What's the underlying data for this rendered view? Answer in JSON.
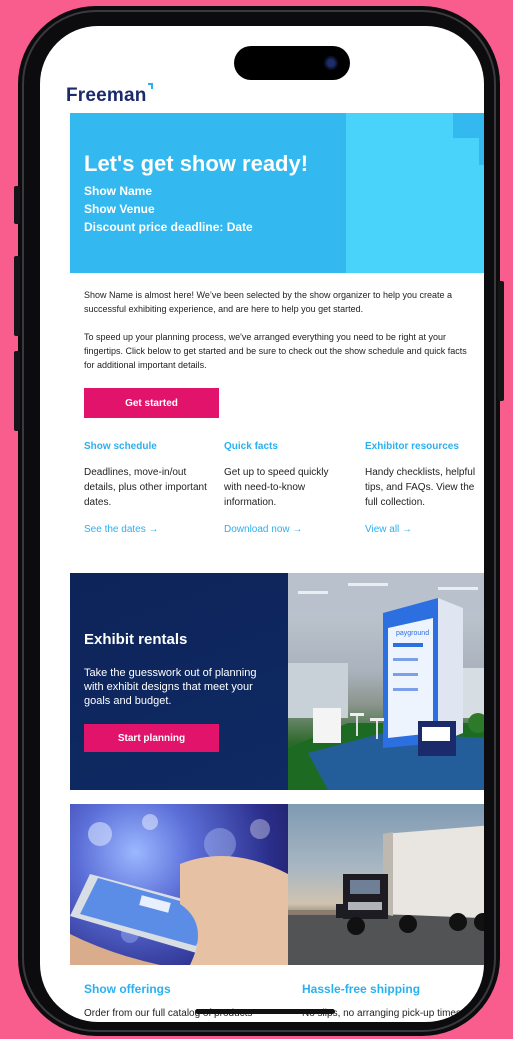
{
  "brand": {
    "logo_text": "Freeman"
  },
  "hero": {
    "title": "Let's get show ready!",
    "line1": "Show Name",
    "line2": "Show Venue",
    "line3": "Discount price deadline: Date",
    "colors": {
      "primary": "#33b8ef",
      "accent": "#4ad3fa"
    }
  },
  "intro": {
    "para1": "Show Name is almost here! We’ve been selected by the show organizer to help you create a successful exhibiting experience, and are here to help you get started.",
    "para2": "To speed up your planning process, we've arranged everything you need to be right at your fingertips. Click below to get started and be sure to check out the show schedule and quick facts for additional important details.",
    "cta_label": "Get started"
  },
  "columns": [
    {
      "title": "Show schedule",
      "body": "Deadlines, move-in/out details, plus other important dates.",
      "link": "See the dates →"
    },
    {
      "title": "Quick facts",
      "body": "Get up to speed quickly with need-to-know information.",
      "link": "Download now →"
    },
    {
      "title": "Exhibitor resources",
      "body": "Handy checklists, helpful tips, and FAQs. View the full collection.",
      "link": "View all →"
    }
  ],
  "rentals": {
    "title": "Exhibit rentals",
    "body": "Take the guesswork out of planning with exhibit designs that meet your goals and budget.",
    "cta_label": "Start planning",
    "booth_brand": "payground"
  },
  "cards": [
    {
      "title": "Show offerings",
      "body": "Order from our full catalog of products"
    },
    {
      "title": "Hassle-free shipping",
      "body": "No slips, no arranging pick-up times,"
    }
  ],
  "colors": {
    "pink": "#e1136b",
    "link_blue": "#2bb0ef",
    "navy": "#0d2459",
    "logo_navy": "#1b2a6b"
  }
}
